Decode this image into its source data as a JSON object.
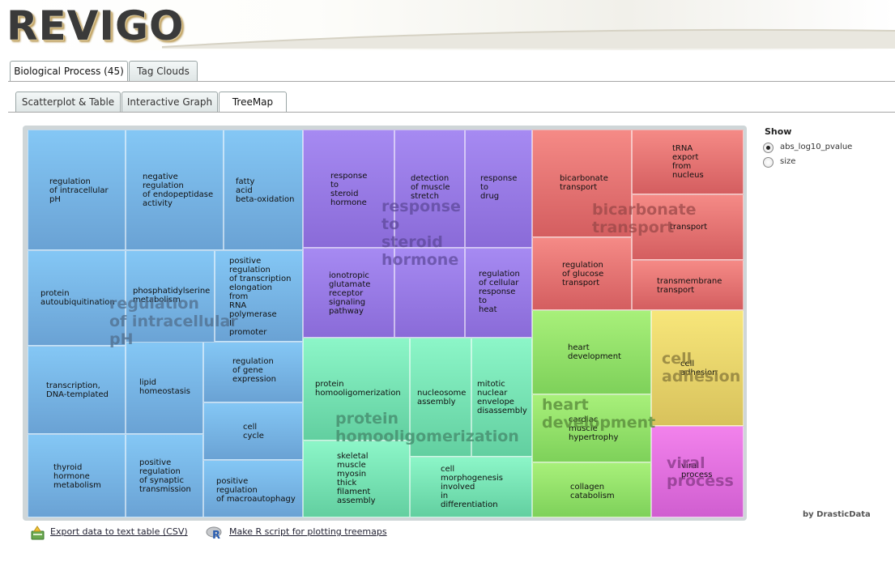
{
  "app": {
    "logo": "REVIGO"
  },
  "tabs_top": [
    {
      "label": "Biological Process (45)",
      "active": true
    },
    {
      "label": "Tag Clouds",
      "active": false
    }
  ],
  "tabs_sub": [
    {
      "label": "Scatterplot & Table",
      "active": false
    },
    {
      "label": "Interactive Graph",
      "active": false
    },
    {
      "label": "TreeMap",
      "active": true
    }
  ],
  "treemap": {
    "cells": [
      "regulation\nof intracellular\npH",
      "negative\nregulation\nof endopeptidase\nactivity",
      "fatty\nacid\nbeta-oxidation",
      "protein\nautoubiquitination",
      "phosphatidylserine\nmetabolism",
      "positive\nregulation\nof transcription\nelongation\nfrom\nRNA\npolymerase\nII\npromoter",
      "transcription,\nDNA-templated",
      "lipid\nhomeostasis",
      "regulation\nof gene\nexpression",
      "cell\ncycle",
      "thyroid\nhormone\nmetabolism",
      "positive\nregulation\nof synaptic\ntransmission",
      "positive\nregulation\nof macroautophagy",
      "response\nto\nsteroid\nhormone",
      "detection\nof muscle\nstretch",
      "response\nto\ndrug",
      "ionotropic\nglutamate\nreceptor\nsignaling\npathway",
      "",
      "regulation\nof cellular\nresponse\nto\nheat",
      "protein\nhomooligomerization",
      "nucleosome\nassembly",
      "mitotic\nnuclear\nenvelope\ndisassembly",
      "skeletal\nmuscle\nmyosin\nthick\nfilament\nassembly",
      "cell\nmorphogenesis\ninvolved\nin\ndifferentiation",
      "bicarbonate\ntransport",
      "tRNA\nexport\nfrom\nnucleus",
      "transport",
      "regulation\nof glucose\ntransport",
      "transmembrane\ntransport",
      "heart\ndevelopment",
      "cardiac\nmuscle\nhypertrophy",
      "collagen\ncatabolism",
      "cell\nadhesion",
      "viral\nprocess"
    ],
    "groups": [
      "regulation\nof intracellular\npH",
      "response\nto\nsteroid\nhormone",
      "protein\nhomooligomerization",
      "bicarbonate\ntransport",
      "heart\ndevelopment",
      "cell\nadhesion",
      "viral\nprocess"
    ]
  },
  "side": {
    "title": "Show",
    "options": [
      {
        "label": "abs_log10_pvalue",
        "selected": true
      },
      {
        "label": "size",
        "selected": false
      }
    ]
  },
  "credit": "by DrasticData",
  "footer": {
    "export_csv": "Export data to text table (CSV)",
    "r_script": "Make R script for plotting treemaps"
  },
  "colors": {
    "blue": "#7ab6e8",
    "purple": "#9a7ae8",
    "red": "#e87476",
    "teal": "#7ae8b4",
    "green": "#94e06a",
    "yellow": "#e8d46a",
    "magenta": "#e070e0"
  }
}
